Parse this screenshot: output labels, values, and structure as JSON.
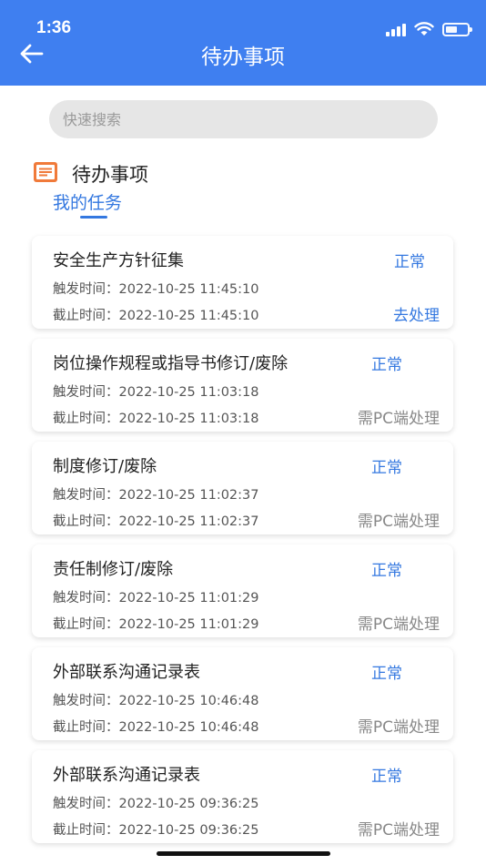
{
  "status_bar": {
    "time": "1:36"
  },
  "header": {
    "title": "待办事项"
  },
  "search": {
    "placeholder": "快速搜索"
  },
  "section": {
    "title": "待办事项",
    "tab": "我的任务"
  },
  "tasks": [
    {
      "title": "安全生产方针征集",
      "status": "正常",
      "trigger": "触发时间：2022-10-25 11:45:10",
      "deadline": "截止时间：2022-10-25 11:45:10",
      "action": "去处理"
    },
    {
      "title": "岗位操作规程或指导书修订/废除",
      "status": "正常",
      "trigger": "触发时间：2022-10-25 11:03:18",
      "deadline": "截止时间：2022-10-25 11:03:18",
      "action": "需PC端处理"
    },
    {
      "title": "制度修订/废除",
      "status": "正常",
      "trigger": "触发时间：2022-10-25 11:02:37",
      "deadline": "截止时间：2022-10-25 11:02:37",
      "action": "需PC端处理"
    },
    {
      "title": "责任制修订/废除",
      "status": "正常",
      "trigger": "触发时间：2022-10-25 11:01:29",
      "deadline": "截止时间：2022-10-25 11:01:29",
      "action": "需PC端处理"
    },
    {
      "title": "外部联系沟通记录表",
      "status": "正常",
      "trigger": "触发时间：2022-10-25 10:46:48",
      "deadline": "截止时间：2022-10-25 10:46:48",
      "action": "需PC端处理"
    },
    {
      "title": "外部联系沟通记录表",
      "status": "正常",
      "trigger": "触发时间：2022-10-25 09:36:25",
      "deadline": "截止时间：2022-10-25 09:36:25",
      "action": "需PC端处理"
    }
  ],
  "colors": {
    "header": "#3f7ff0",
    "accent": "#3478e0",
    "section_icon": "#f07a3a",
    "muted": "#888888"
  },
  "icons": {
    "back": "arrow-left-icon",
    "section": "document-icon",
    "signal": "signal-icon",
    "wifi": "wifi-icon",
    "battery": "battery-icon"
  }
}
